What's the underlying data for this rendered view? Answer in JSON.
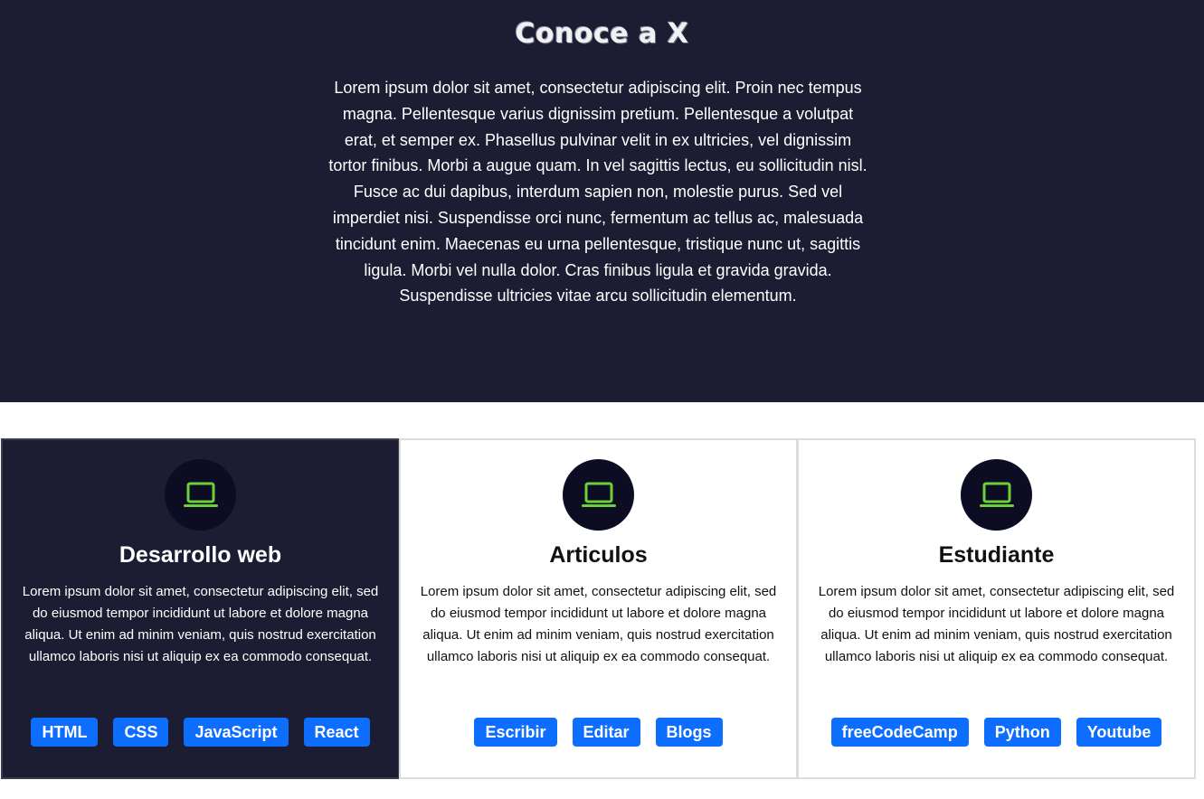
{
  "hero": {
    "title": "Conoce a X",
    "text": "Lorem ipsum dolor sit amet, consectetur adipiscing elit. Proin nec tempus magna. Pellentesque varius dignissim pretium. Pellentesque a volutpat erat, et semper ex. Phasellus pulvinar velit in ex ultricies, vel dignissim tortor finibus. Morbi a augue quam. In vel sagittis lectus, eu sollicitudin nisl. Fusce ac dui dapibus, interdum sapien non, molestie purus. Sed vel imperdiet nisi. Suspendisse orci nunc, fermentum ac tellus ac, malesuada tincidunt enim. Maecenas eu urna pellentesque, tristique nunc ut, sagittis ligula. Morbi vel nulla dolor. Cras finibus ligula et gravida gravida. Suspendisse ultricies vitae arcu sollicitudin elementum."
  },
  "colors": {
    "hero_bg": "#1c1c33",
    "icon_circle": "#0c0c22",
    "icon_green": "#6ad13a",
    "tag_blue": "#0d6efd"
  },
  "cards": [
    {
      "icon": "laptop-icon",
      "title": "Desarrollo web",
      "text": "Lorem ipsum dolor sit amet, consectetur adipiscing elit, sed do eiusmod tempor incididunt ut labore et dolore magna aliqua. Ut enim ad minim veniam, quis nostrud exercitation ullamco laboris nisi ut aliquip ex ea commodo consequat.",
      "tags": [
        "HTML",
        "CSS",
        "JavaScript",
        "React"
      ]
    },
    {
      "icon": "laptop-icon",
      "title": "Articulos",
      "text": "Lorem ipsum dolor sit amet, consectetur adipiscing elit, sed do eiusmod tempor incididunt ut labore et dolore magna aliqua. Ut enim ad minim veniam, quis nostrud exercitation ullamco laboris nisi ut aliquip ex ea commodo consequat.",
      "tags": [
        "Escribir",
        "Editar",
        "Blogs"
      ]
    },
    {
      "icon": "laptop-icon",
      "title": "Estudiante",
      "text": "Lorem ipsum dolor sit amet, consectetur adipiscing elit, sed do eiusmod tempor incididunt ut labore et dolore magna aliqua. Ut enim ad minim veniam, quis nostrud exercitation ullamco laboris nisi ut aliquip ex ea commodo consequat.",
      "tags": [
        "freeCodeCamp",
        "Python",
        "Youtube"
      ]
    }
  ]
}
